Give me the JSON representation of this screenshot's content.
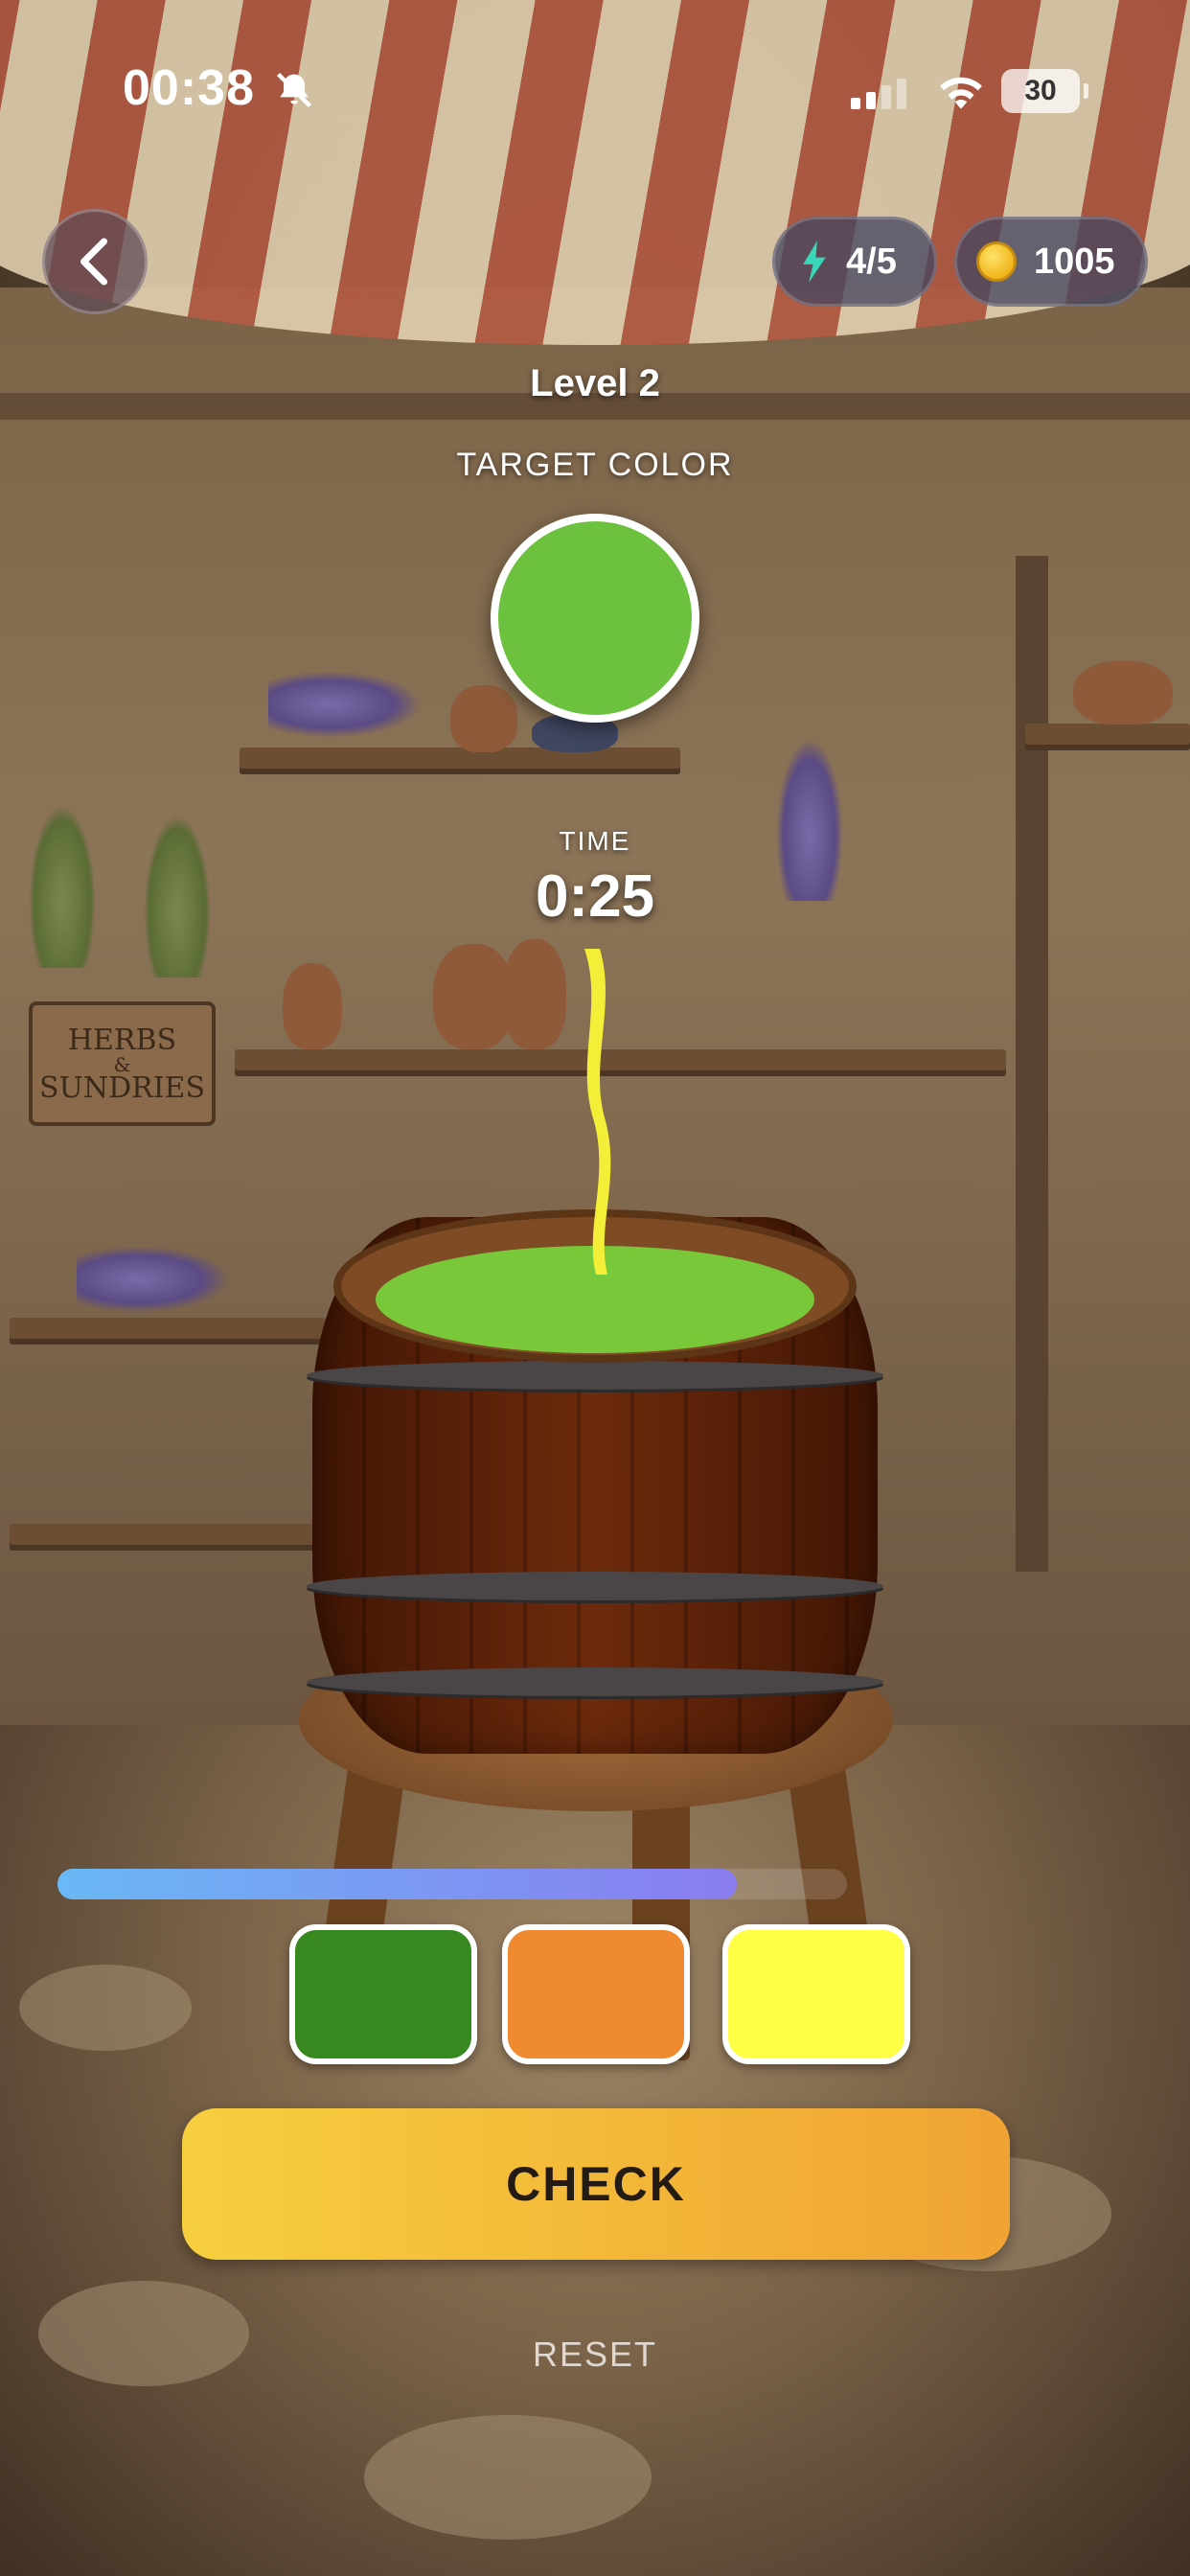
{
  "status_bar": {
    "time": "00:38",
    "battery": "30",
    "icons": [
      "bell-slash-icon",
      "signal-icon",
      "wifi-icon",
      "battery-icon"
    ]
  },
  "hud": {
    "back_icon": "chevron-left-icon",
    "energy": {
      "icon": "lightning-icon",
      "value": "4/5",
      "color": "#3ad6b8"
    },
    "coins": {
      "icon": "coin-icon",
      "value": "1005"
    }
  },
  "game": {
    "level_label": "Level 2",
    "target_label": "TARGET COLOR",
    "target_color": "#6cc23e",
    "time_label": "TIME",
    "time_value": "0:25",
    "mix_color": "#78c83a",
    "pour_color": "#f3ef38",
    "progress": 0.86,
    "swatches": [
      {
        "name": "dark-green",
        "color": "#37881f"
      },
      {
        "name": "orange",
        "color": "#f08a30"
      },
      {
        "name": "yellow",
        "color": "#fefe45"
      }
    ],
    "check_label": "CHECK",
    "reset_label": "RESET"
  },
  "scene": {
    "sign_text": [
      "HERBS",
      "&",
      "SUNDRIES"
    ]
  }
}
